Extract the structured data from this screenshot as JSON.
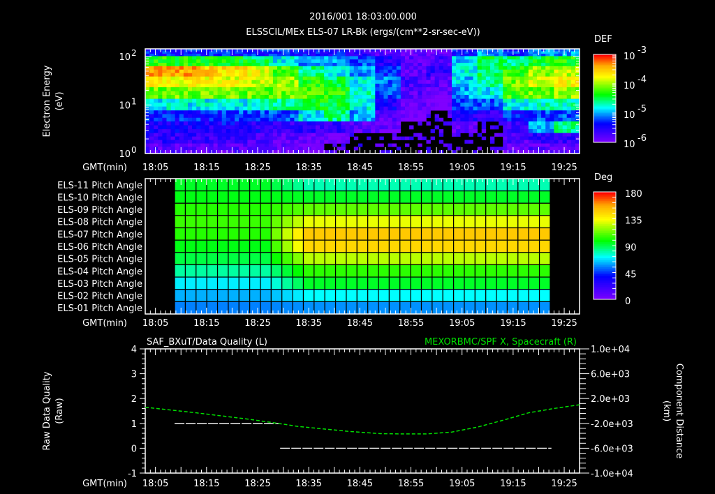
{
  "header": {
    "datetime": "2016/001 18:03:00.000",
    "title": "ELSSCIL/MEx ELS-07 LR-Bk  (ergs/(cm**2-sr-sec-eV))"
  },
  "colors": {
    "background": "#000000",
    "axis": "#ffffff",
    "right_series": "#00e000",
    "left_series": "#ffffff"
  },
  "chart_data": [
    {
      "type": "heatmap",
      "name": "electron-spectrogram",
      "ylabel": "Electron Energy",
      "ylabel_unit": "(eV)",
      "xlabel": "GMT(min)",
      "x_tick_labels": [
        "18:05",
        "18:15",
        "18:25",
        "18:35",
        "18:45",
        "18:55",
        "19:05",
        "19:15",
        "19:25"
      ],
      "x_range_min": [
        0,
        85
      ],
      "y_scale": "log",
      "y_range": [
        1,
        150
      ],
      "y_tick_labels": [
        {
          "base": "10",
          "exp": "2",
          "value": 100
        },
        {
          "base": "10",
          "exp": "1",
          "value": 10
        },
        {
          "base": "10",
          "exp": "0",
          "value": 1
        }
      ],
      "colorbar": {
        "label": "DEF",
        "log10_range": [
          -6,
          -3
        ],
        "tick_labels": [
          {
            "base": "10",
            "exp": "-3",
            "value": -3
          },
          {
            "base": "10",
            "exp": "-4",
            "value": -4
          },
          {
            "base": "10",
            "exp": "-5",
            "value": -5
          },
          {
            "base": "10",
            "exp": "-6",
            "value": -6
          }
        ]
      },
      "time_bin_min": 5,
      "energies_eV": [
        130,
        80,
        50,
        30,
        18,
        10,
        6,
        3.5,
        2,
        1.3
      ],
      "log10_def": [
        [
          -5.3,
          -4.3,
          -3.4,
          -3.7,
          -4.1,
          -4.8,
          -5.3,
          -5.5,
          -5.6,
          -5.8
        ],
        [
          -5.3,
          -4.3,
          -3.4,
          -3.7,
          -4.1,
          -4.8,
          -5.3,
          -5.5,
          -5.6,
          -5.8
        ],
        [
          -5.3,
          -4.3,
          -3.5,
          -3.7,
          -4.1,
          -4.8,
          -5.3,
          -5.5,
          -5.6,
          -5.8
        ],
        [
          -5.3,
          -4.4,
          -3.6,
          -3.8,
          -4.1,
          -4.8,
          -5.2,
          -5.4,
          -5.6,
          -5.8
        ],
        [
          -5.3,
          -4.5,
          -3.8,
          -3.9,
          -4.1,
          -4.7,
          -5.2,
          -5.5,
          -5.7,
          -5.8
        ],
        [
          -5.3,
          -4.8,
          -4.2,
          -4.0,
          -4.1,
          -4.6,
          -5.2,
          -5.6,
          -5.8,
          -5.9
        ],
        [
          -5.4,
          -5.0,
          -4.6,
          -4.3,
          -4.2,
          -4.4,
          -4.8,
          -5.6,
          -5.9,
          -6.0
        ],
        [
          -5.4,
          -5.0,
          -4.8,
          -4.5,
          -4.3,
          -4.4,
          -4.6,
          -5.6,
          -6.0,
          null
        ],
        [
          -5.6,
          -5.2,
          -5.0,
          -4.8,
          -4.7,
          -4.8,
          -5.0,
          -5.8,
          null,
          null
        ],
        [
          -5.8,
          -5.5,
          -5.3,
          -5.1,
          -5.2,
          -5.5,
          -5.8,
          -5.9,
          null,
          null
        ],
        [
          -5.9,
          -5.8,
          -5.8,
          -5.7,
          -5.8,
          -5.9,
          -6.0,
          null,
          null,
          null
        ],
        [
          -5.9,
          -5.7,
          -5.6,
          -5.8,
          -5.9,
          -6.0,
          null,
          null,
          null,
          null
        ],
        [
          -5.4,
          -4.9,
          -4.8,
          -4.9,
          -5.0,
          -5.2,
          -5.5,
          -5.9,
          null,
          null
        ],
        [
          -5.0,
          -4.5,
          -4.5,
          -4.6,
          -4.8,
          -5.2,
          -5.6,
          null,
          null,
          null
        ],
        [
          -5.3,
          -4.6,
          -4.3,
          -4.1,
          -4.2,
          -4.8,
          -5.3,
          -5.6,
          -5.8,
          -5.9
        ],
        [
          -5.1,
          -4.4,
          -4.0,
          -3.8,
          -4.1,
          -4.7,
          -5.2,
          -5.0,
          -5.6,
          -5.8
        ],
        [
          -5.0,
          -4.3,
          -3.9,
          -3.7,
          -4.0,
          -4.7,
          -5.2,
          -4.6,
          -5.6,
          -5.8
        ]
      ]
    },
    {
      "type": "heatmap",
      "name": "pitch-angle",
      "xlabel": "GMT(min)",
      "x_tick_labels": [
        "18:05",
        "18:15",
        "18:25",
        "18:35",
        "18:45",
        "18:55",
        "19:05",
        "19:15",
        "19:25"
      ],
      "colorbar": {
        "label": "Deg",
        "range": [
          0,
          180
        ],
        "tick_labels": [
          "180",
          "135",
          "90",
          "45",
          "0"
        ]
      },
      "start_min": 5.75,
      "col_width_min": 2.1,
      "n_cols": 35,
      "transition_cols": [
        8,
        12
      ],
      "rows": [
        {
          "label": "ELS-11 Pitch Angle",
          "early_deg": 95,
          "late_deg": 80
        },
        {
          "label": "ELS-10 Pitch Angle",
          "early_deg": 97,
          "late_deg": 95
        },
        {
          "label": "ELS-09 Pitch Angle",
          "early_deg": 104,
          "late_deg": 112
        },
        {
          "label": "ELS-08 Pitch Angle",
          "early_deg": 107,
          "late_deg": 132
        },
        {
          "label": "ELS-07 Pitch Angle",
          "early_deg": 104,
          "late_deg": 150
        },
        {
          "label": "ELS-06 Pitch Angle",
          "early_deg": 97,
          "late_deg": 146
        },
        {
          "label": "ELS-05 Pitch Angle",
          "early_deg": 92,
          "late_deg": 125
        },
        {
          "label": "ELS-04 Pitch Angle",
          "early_deg": 82,
          "late_deg": 105
        },
        {
          "label": "ELS-03 Pitch Angle",
          "early_deg": 70,
          "late_deg": 95
        },
        {
          "label": "ELS-02 Pitch Angle",
          "early_deg": 62,
          "late_deg": 72
        },
        {
          "label": "ELS-01 Pitch Angle",
          "early_deg": 56,
          "late_deg": 58
        }
      ]
    },
    {
      "type": "line",
      "name": "data-quality-and-position",
      "title_left": "SAF_BXuT/Data Quality (L)",
      "title_right": "MEXORBMC/SPF X, Spacecraft (R)",
      "xlabel": "GMT(min)",
      "x_tick_labels": [
        "18:05",
        "18:15",
        "18:25",
        "18:35",
        "18:45",
        "18:55",
        "19:05",
        "19:15",
        "19:25"
      ],
      "ylabel_left": "Raw Data Quality",
      "ylabel_left_unit": "(Raw)",
      "ylim_left": [
        -1,
        4
      ],
      "y_tick_labels_left": [
        "4",
        "3",
        "2",
        "1",
        "0",
        "-1"
      ],
      "ylabel_right": "Component Distance",
      "ylabel_right_unit": "(km)",
      "ylim_right": [
        -10000,
        10000
      ],
      "y_tick_labels_right": [
        "1.0e+04",
        "6.0e+03",
        "2.0e+03",
        "-2.0e+03",
        "-6.0e+03",
        "-1.0e+04"
      ],
      "series_left": {
        "name": "Data Quality",
        "segments": [
          {
            "x_min": [
              5.75,
              26.2
            ],
            "y": 1
          },
          {
            "x_min": [
              26.4,
              79.5
            ],
            "y": 0
          }
        ]
      },
      "series_right": {
        "name": "SPF X",
        "x_min": [
          0,
          10,
          20,
          26,
          30,
          40,
          46,
          50,
          55,
          60,
          65,
          70,
          75,
          80,
          85
        ],
        "y_km": [
          600,
          -300,
          -1300,
          -2000,
          -2500,
          -3300,
          -3650,
          -3700,
          -3700,
          -3400,
          -2600,
          -1500,
          -300,
          400,
          1000
        ]
      }
    }
  ]
}
